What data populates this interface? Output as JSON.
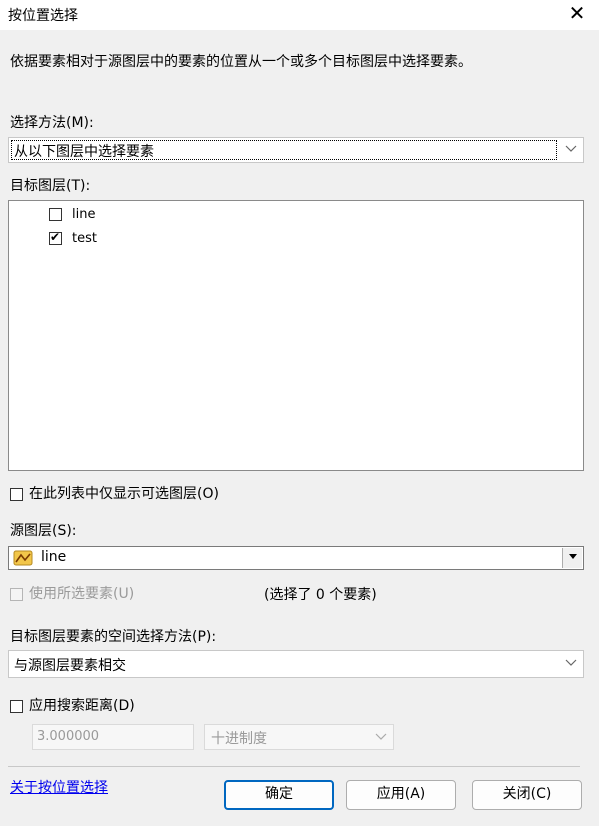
{
  "window": {
    "title": "按位置选择",
    "close_glyph": "✕"
  },
  "description": "依据要素相对于源图层中的要素的位置从一个或多个目标图层中选择要素。",
  "selection_method": {
    "label": "选择方法(M):",
    "value": "从以下图层中选择要素"
  },
  "target_layers": {
    "label": "目标图层(T):",
    "items": [
      {
        "name": "line",
        "checked": false
      },
      {
        "name": "test",
        "checked": true
      }
    ]
  },
  "only_selectable": {
    "label": "在此列表中仅显示可选图层(O)",
    "checked": false
  },
  "source_layer": {
    "label": "源图层(S):",
    "value": "line",
    "icon": "polyline-layer-icon"
  },
  "use_selected": {
    "label": "使用所选要素(U)",
    "checked": false,
    "enabled": false,
    "selected_count_text": "(选择了 0 个要素)"
  },
  "spatial_method": {
    "label": "目标图层要素的空间选择方法(P):",
    "value": "与源图层要素相交"
  },
  "search_distance": {
    "label": "应用搜索距离(D)",
    "checked": false,
    "value": "3.000000",
    "unit": "十进制度"
  },
  "footer": {
    "help_link": "关于按位置选择",
    "ok": "确定",
    "apply": "应用(A)",
    "close": "关闭(C)"
  },
  "colors": {
    "accent": "#0067c0",
    "link": "#0000ee"
  }
}
